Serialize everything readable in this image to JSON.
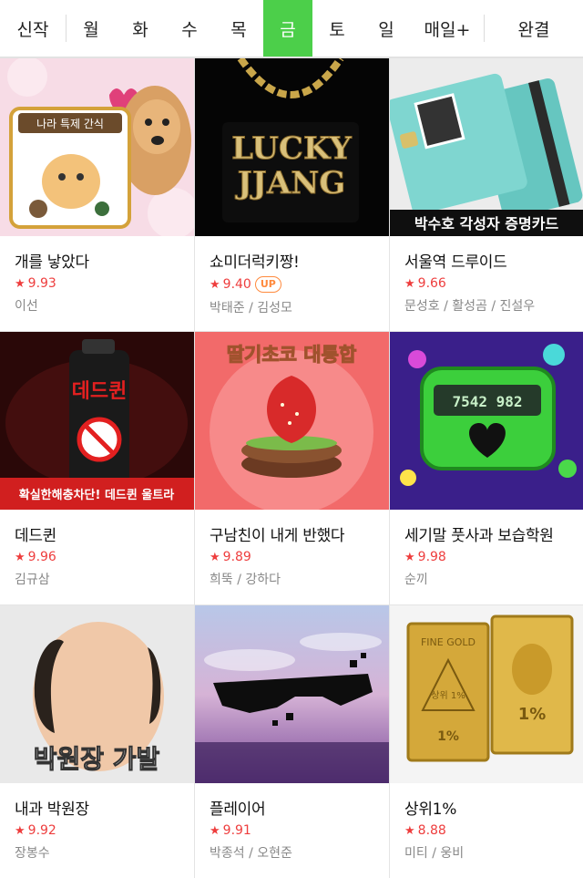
{
  "tabs": [
    {
      "label": "신작"
    },
    {
      "label": "월"
    },
    {
      "label": "화"
    },
    {
      "label": "수"
    },
    {
      "label": "목"
    },
    {
      "label": "금"
    },
    {
      "label": "토"
    },
    {
      "label": "일"
    },
    {
      "label": "매일+"
    },
    {
      "label": "완결"
    }
  ],
  "active_tab": "금",
  "accent_color": "#4ccf4a",
  "rating_color": "#ee3d3d",
  "comics": [
    {
      "title": "개를 낳았다",
      "rating": "9.93",
      "author": "이선",
      "cover_text": [
        "나라 특제 간식"
      ]
    },
    {
      "title": "쇼미더럭키짱!",
      "rating": "9.40",
      "badge": "UP",
      "author": "박태준 / 김성모",
      "cover_text": [
        "LUCKY",
        "JJANG"
      ]
    },
    {
      "title": "서울역 드루이드",
      "rating": "9.66",
      "author": "문성호 / 활성곰 / 진설우",
      "cover_text": [
        "박수호 각성자 증명카드"
      ]
    },
    {
      "title": "데드퀸",
      "rating": "9.96",
      "author": "김규삼",
      "cover_text": [
        "데드퀸",
        "확실한해충차단! 데드퀸 울트라"
      ]
    },
    {
      "title": "구남친이 내게 반했다",
      "rating": "9.89",
      "author": "희뚝 / 강하다",
      "cover_text": [
        "딸기초코 대통합"
      ]
    },
    {
      "title": "세기말 풋사과 보습학원",
      "rating": "9.98",
      "author": "순끼",
      "cover_text": [
        "7542 982"
      ]
    },
    {
      "title": "내과 박원장",
      "rating": "9.92",
      "author": "장봉수",
      "cover_text": [
        "박원장 가발"
      ]
    },
    {
      "title": "플레이어",
      "rating": "9.91",
      "author": "박종석 / 오현준",
      "cover_text": []
    },
    {
      "title": "상위1%",
      "rating": "8.88",
      "author": "미티 / 웅비",
      "cover_text": [
        "FINE GOLD",
        "상위 1%",
        "1%"
      ]
    }
  ]
}
